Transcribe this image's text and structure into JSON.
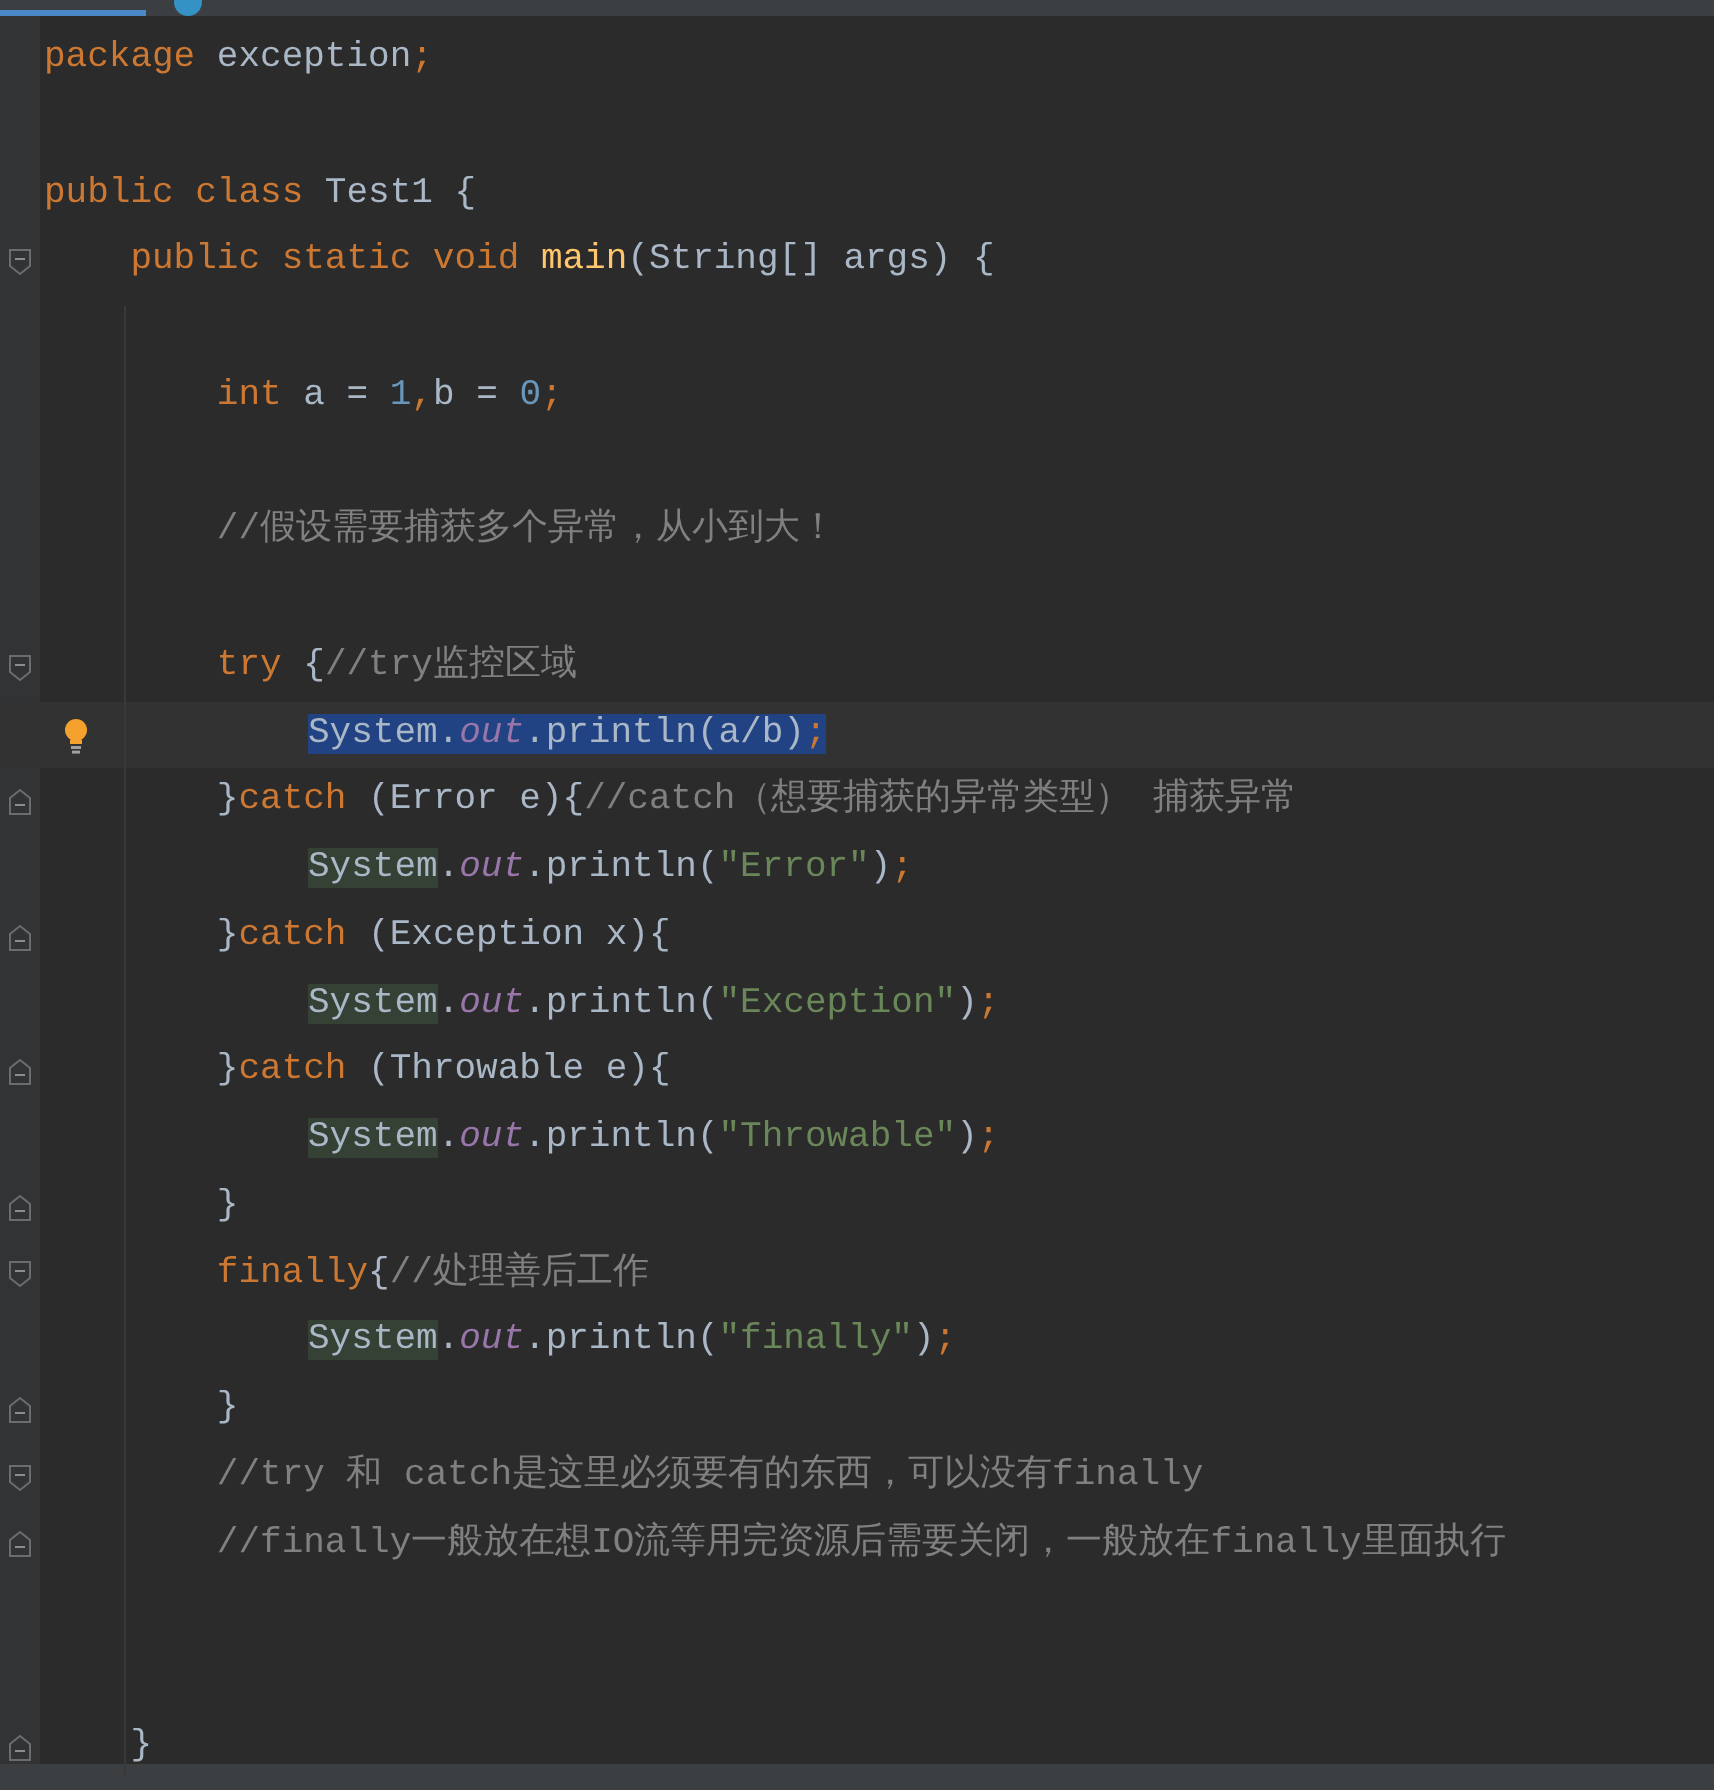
{
  "tabs": [
    {
      "selected": true
    },
    {
      "selected": false,
      "icon": true
    }
  ],
  "lines": [
    {
      "kind": "code",
      "tokens": [
        {
          "text": "package",
          "kind": "kw"
        },
        {
          "text": " exception",
          "kind": "plain"
        },
        {
          "text": ";",
          "kind": "kw"
        }
      ]
    },
    {
      "kind": "blank"
    },
    {
      "kind": "code",
      "tokens": [
        {
          "text": "public class",
          "kind": "kw"
        },
        {
          "text": " Test1 {",
          "kind": "plain"
        }
      ]
    },
    {
      "kind": "code",
      "fold_start": true,
      "tokens": [
        {
          "text": "    public static void ",
          "kind": "kw"
        },
        {
          "text": "main",
          "kind": "method"
        },
        {
          "text": "(String[] args) {",
          "kind": "plain"
        }
      ]
    },
    {
      "kind": "blank"
    },
    {
      "kind": "code",
      "tokens": [
        {
          "text": "        int",
          "kind": "kw"
        },
        {
          "text": " a = ",
          "kind": "plain"
        },
        {
          "text": "1",
          "kind": "num"
        },
        {
          "text": ",",
          "kind": "kw"
        },
        {
          "text": "b = ",
          "kind": "plain"
        },
        {
          "text": "0",
          "kind": "num"
        },
        {
          "text": ";",
          "kind": "kw"
        }
      ]
    },
    {
      "kind": "blank"
    },
    {
      "kind": "code",
      "tokens": [
        {
          "text": "        //假设需要捕获多个异常，从小到大！",
          "kind": "comment"
        }
      ]
    },
    {
      "kind": "blank"
    },
    {
      "kind": "code",
      "fold_start": true,
      "tokens": [
        {
          "text": "        try",
          "kind": "kw"
        },
        {
          "text": " {",
          "kind": "plain"
        },
        {
          "text": "//try监控区域",
          "kind": "comment"
        }
      ]
    },
    {
      "kind": "inner",
      "bulb": true,
      "current": true,
      "selected": true,
      "tokens": [
        {
          "text": "System.",
          "kind": "plain"
        },
        {
          "text": "out",
          "kind": "field"
        },
        {
          "text": ".println(a/b)",
          "kind": "plain"
        },
        {
          "text": ";",
          "kind": "kw"
        }
      ]
    },
    {
      "kind": "code",
      "fold_end": true,
      "tokens": [
        {
          "text": "        }",
          "kind": "plain"
        },
        {
          "text": "catch",
          "kind": "kw"
        },
        {
          "text": " (Error e){",
          "kind": "plain"
        },
        {
          "text": "//catch（想要捕获的异常类型） 捕获异常",
          "kind": "comment"
        }
      ]
    },
    {
      "kind": "inner",
      "tokens": [
        {
          "text": "System",
          "kind": "usage"
        },
        {
          "text": ".",
          "kind": "plain"
        },
        {
          "text": "out",
          "kind": "field"
        },
        {
          "text": ".println(",
          "kind": "plain"
        },
        {
          "text": "\"Error\"",
          "kind": "str"
        },
        {
          "text": ")",
          "kind": "plain"
        },
        {
          "text": ";",
          "kind": "kw"
        }
      ]
    },
    {
      "kind": "code",
      "fold_end": true,
      "tokens": [
        {
          "text": "        }",
          "kind": "plain"
        },
        {
          "text": "catch",
          "kind": "kw"
        },
        {
          "text": " (Exception x){",
          "kind": "plain"
        }
      ]
    },
    {
      "kind": "inner",
      "tokens": [
        {
          "text": "System",
          "kind": "usage"
        },
        {
          "text": ".",
          "kind": "plain"
        },
        {
          "text": "out",
          "kind": "field"
        },
        {
          "text": ".println(",
          "kind": "plain"
        },
        {
          "text": "\"Exception\"",
          "kind": "str"
        },
        {
          "text": ")",
          "kind": "plain"
        },
        {
          "text": ";",
          "kind": "kw"
        }
      ]
    },
    {
      "kind": "code",
      "fold_end": true,
      "tokens": [
        {
          "text": "        }",
          "kind": "plain"
        },
        {
          "text": "catch",
          "kind": "kw"
        },
        {
          "text": " (Throwable e){",
          "kind": "plain"
        }
      ]
    },
    {
      "kind": "inner",
      "tokens": [
        {
          "text": "System",
          "kind": "usage"
        },
        {
          "text": ".",
          "kind": "plain"
        },
        {
          "text": "out",
          "kind": "field"
        },
        {
          "text": ".println(",
          "kind": "plain"
        },
        {
          "text": "\"Throwable\"",
          "kind": "str"
        },
        {
          "text": ")",
          "kind": "plain"
        },
        {
          "text": ";",
          "kind": "kw"
        }
      ]
    },
    {
      "kind": "code",
      "fold_end": true,
      "tokens": [
        {
          "text": "        }",
          "kind": "plain"
        }
      ]
    },
    {
      "kind": "code",
      "fold_start": true,
      "tokens": [
        {
          "text": "        finally",
          "kind": "kw"
        },
        {
          "text": "{",
          "kind": "plain"
        },
        {
          "text": "//处理善后工作",
          "kind": "comment"
        }
      ]
    },
    {
      "kind": "inner",
      "tokens": [
        {
          "text": "System",
          "kind": "usage"
        },
        {
          "text": ".",
          "kind": "plain"
        },
        {
          "text": "out",
          "kind": "field"
        },
        {
          "text": ".println(",
          "kind": "plain"
        },
        {
          "text": "\"finally\"",
          "kind": "str"
        },
        {
          "text": ")",
          "kind": "plain"
        },
        {
          "text": ";",
          "kind": "kw"
        }
      ]
    },
    {
      "kind": "code",
      "fold_end": true,
      "tokens": [
        {
          "text": "        }",
          "kind": "plain"
        }
      ]
    },
    {
      "kind": "code",
      "fold_start": true,
      "tokens": [
        {
          "text": "        //try 和 catch是这里必须要有的东西，可以没有finally",
          "kind": "comment"
        }
      ]
    },
    {
      "kind": "code",
      "fold_end": true,
      "tokens": [
        {
          "text": "        //finally一般放在想IO流等用完资源后需要关闭，一般放在finally里面执行",
          "kind": "comment"
        }
      ]
    },
    {
      "kind": "blank"
    },
    {
      "kind": "blank"
    },
    {
      "kind": "code",
      "fold_end": true,
      "tokens": [
        {
          "text": "    }",
          "kind": "plain"
        }
      ]
    }
  ]
}
